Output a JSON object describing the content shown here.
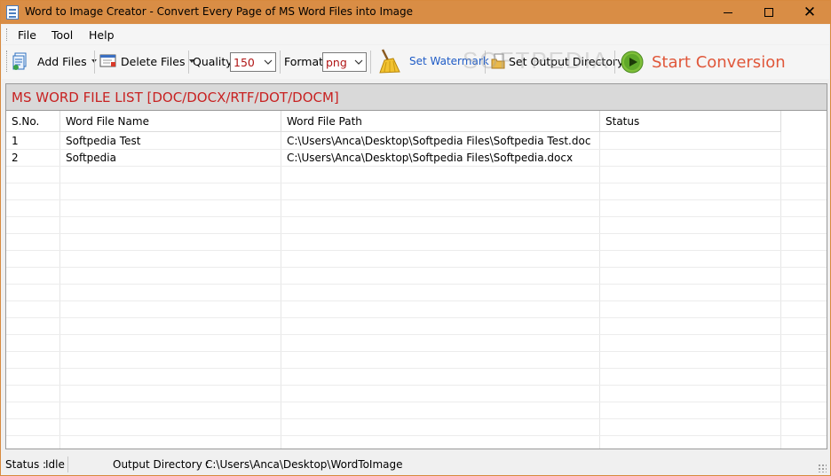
{
  "window": {
    "title": "Word to Image Creator - Convert Every Page of MS Word Files into Image"
  },
  "menu": {
    "items": [
      "File",
      "Tool",
      "Help"
    ]
  },
  "toolbar": {
    "add_files": "Add Files",
    "delete_files": "Delete Files",
    "quality_label": "Quality",
    "quality_value": "150",
    "format_label": "Format",
    "format_value": "png",
    "set_watermark": "Set Watermark",
    "set_output_directory": "Set Output Directory",
    "start_conversion": "Start Conversion"
  },
  "watermark_overlay": "SOFTPEDIA",
  "list": {
    "title": "MS WORD FILE LIST [DOC/DOCX/RTF/DOT/DOCM]",
    "columns": [
      "S.No.",
      "Word File Name",
      "Word File Path",
      "Status"
    ],
    "rows": [
      {
        "sno": "1",
        "name": "Softpedia Test",
        "path": "C:\\Users\\Anca\\Desktop\\Softpedia Files\\Softpedia Test.doc",
        "status": ""
      },
      {
        "sno": "2",
        "name": "Softpedia",
        "path": "C:\\Users\\Anca\\Desktop\\Softpedia Files\\Softpedia.docx",
        "status": ""
      }
    ]
  },
  "status": {
    "label": "Status :",
    "value": "Idle",
    "output_label": "Output Directory :",
    "output_value": "C:\\Users\\Anca\\Desktop\\WordToImage"
  },
  "colors": {
    "titlebar": "#d98d45",
    "list_title": "#c82222",
    "start_conversion": "#e0573a",
    "watermark_link": "#1e5bc6"
  }
}
